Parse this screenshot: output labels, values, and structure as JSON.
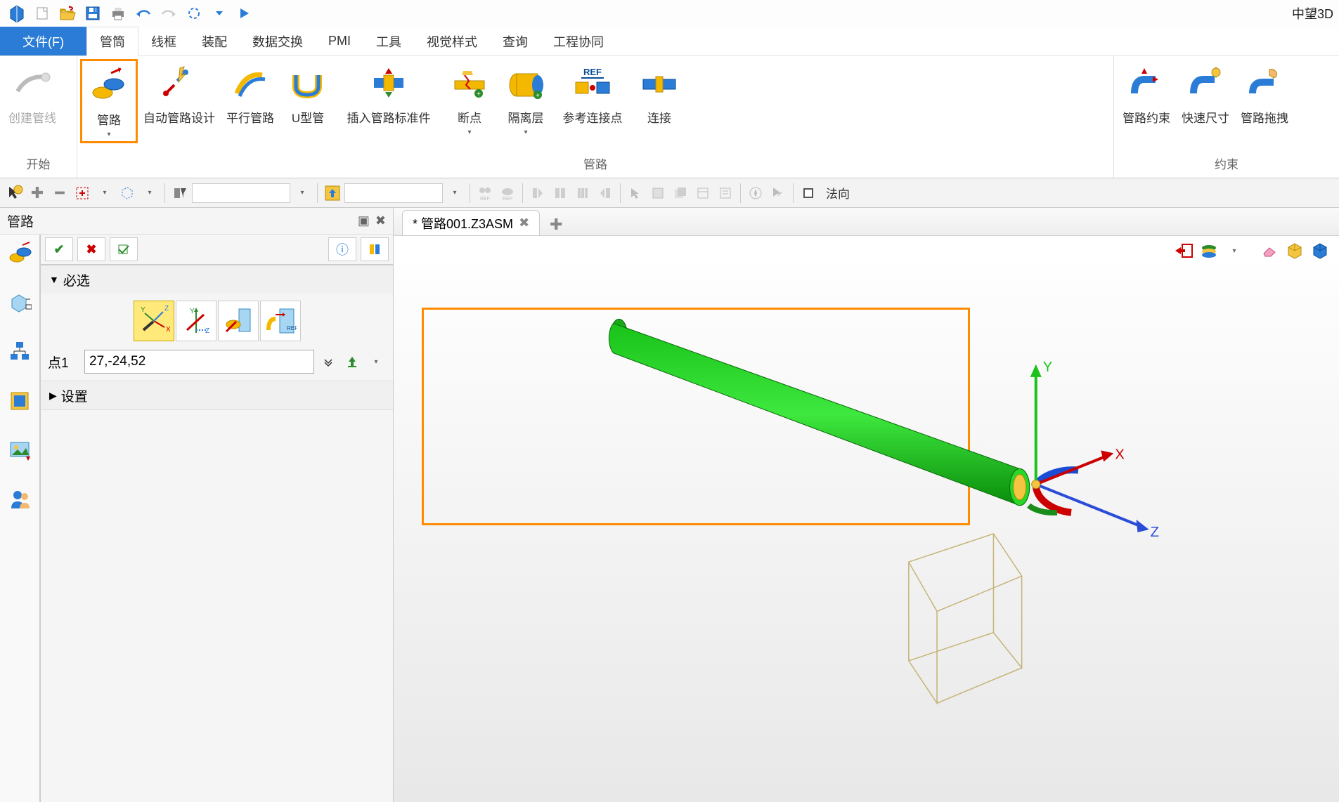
{
  "app_title": "中望3D",
  "menu": {
    "file": "文件(F)",
    "tabs": [
      "管筒",
      "线框",
      "装配",
      "数据交换",
      "PMI",
      "工具",
      "视觉样式",
      "查询",
      "工程协同"
    ],
    "active_index": 0
  },
  "ribbon": {
    "groups": [
      {
        "name": "开始",
        "items": [
          {
            "key": "create-pipeline",
            "label": "创建管线",
            "disabled": true
          }
        ]
      },
      {
        "name": "管路",
        "items": [
          {
            "key": "pipe",
            "label": "管路",
            "highlighted": true,
            "dropdown": true
          },
          {
            "key": "auto-pipe",
            "label": "自动管路设计"
          },
          {
            "key": "parallel-pipe",
            "label": "平行管路"
          },
          {
            "key": "u-pipe",
            "label": "U型管"
          },
          {
            "key": "insert-std",
            "label": "插入管路标准件"
          },
          {
            "key": "break-pt",
            "label": "断点",
            "dropdown": true
          },
          {
            "key": "isolation",
            "label": "隔离层",
            "dropdown": true
          },
          {
            "key": "ref-conn",
            "label": "参考连接点"
          },
          {
            "key": "connect",
            "label": "连接"
          }
        ]
      },
      {
        "name": "约束",
        "items": [
          {
            "key": "pipe-constraint",
            "label": "管路约束"
          },
          {
            "key": "quick-dim",
            "label": "快速尺寸"
          },
          {
            "key": "pipe-drag",
            "label": "管路拖拽"
          }
        ]
      }
    ]
  },
  "toolbar2": {
    "normal_label": "法向"
  },
  "panel": {
    "title": "管路",
    "sections": {
      "required": {
        "label": "必选",
        "expanded": true
      },
      "settings": {
        "label": "设置",
        "expanded": false
      }
    },
    "point1": {
      "label": "点1",
      "value": "27,-24,52"
    }
  },
  "document": {
    "tab_label": "* 管路001.Z3ASM"
  },
  "axes": {
    "x": "X",
    "y": "Y",
    "z": "Z"
  }
}
